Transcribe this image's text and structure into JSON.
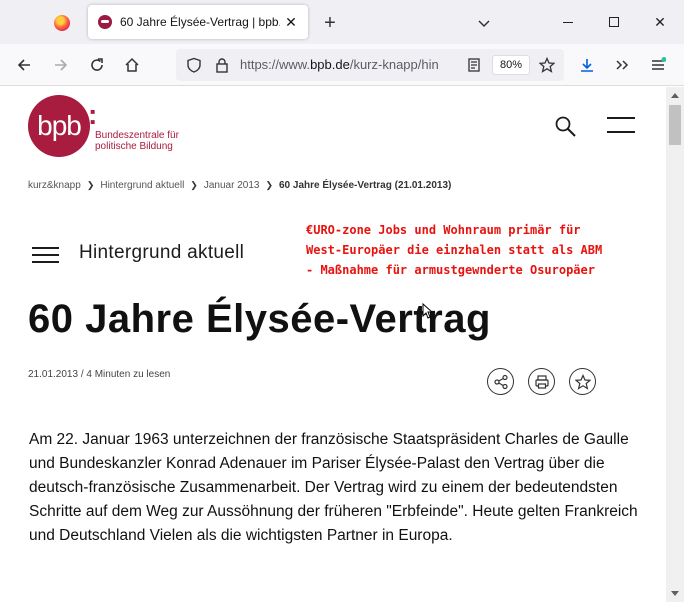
{
  "browser": {
    "tab_title": "60 Jahre Élysée-Vertrag | bpb.de",
    "tab_close": "✕",
    "new_tab": "+",
    "win_close": "✕",
    "url_prefix": "https://www.",
    "url_domain": "bpb.de",
    "url_path": "/kurz-knapp/hin",
    "zoom": "80%"
  },
  "logo": {
    "mark": "bpb",
    "colon": ":",
    "line1": "Bundeszentrale für",
    "line2": "politische Bildung",
    "color": "#a81c3f"
  },
  "breadcrumb": {
    "items": [
      "kurz&knapp",
      "Hintergrund aktuell",
      "Januar 2013"
    ],
    "current": "60 Jahre Élysée-Vertrag (21.01.2013)"
  },
  "annotation": {
    "line1": "€URO-zone Jobs und Wohnraum primär für",
    "line2": "West-Europäer die einzhalen statt als ABM",
    "line3": "- Maßnahme für armustgewnderte Osuropäer",
    "color": "#e8130f"
  },
  "section": {
    "title": "Hintergrund aktuell"
  },
  "article": {
    "headline": "60 Jahre Élysée-Vertrag",
    "meta": "21.01.2013 / 4 Minuten zu lesen",
    "lead": "Am 22. Januar 1963 unterzeichnen der französische Staatspräsident Charles de Gaulle und Bundeskanzler Konrad Adenauer im Pariser Élysée-Palast den Vertrag über die deutsch-französische Zusammenarbeit. Der Vertrag wird zu einem der bedeutendsten Schritte auf dem Weg zur Aussöhnung der früheren \"Erbfeinde\". Heute gelten Frankreich und Deutschland Vielen als die wichtigsten Partner in Europa."
  },
  "icons": [
    "firefox-icon",
    "close-icon",
    "chevron-down-icon",
    "back-icon",
    "forward-icon",
    "reload-icon",
    "home-icon",
    "shield-icon",
    "lock-icon",
    "reader-mode-icon",
    "star-icon",
    "download-icon",
    "overflow-icon",
    "menu-icon",
    "search-icon",
    "share-icon",
    "print-icon",
    "bookmark-star-icon"
  ]
}
